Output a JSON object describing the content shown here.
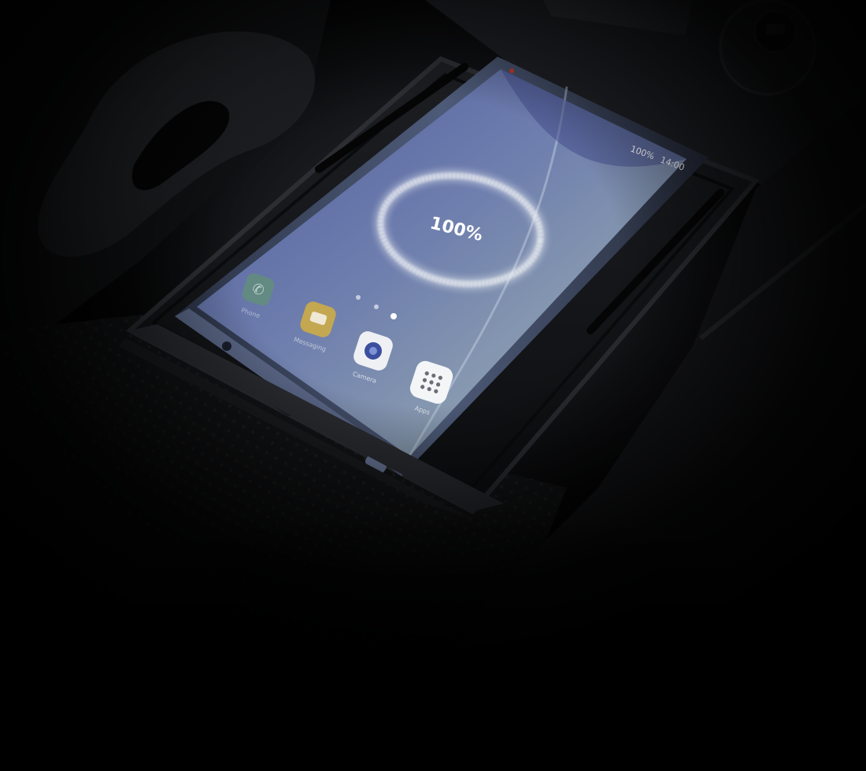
{
  "phone": {
    "status": {
      "battery": "100%",
      "time": "14:00"
    },
    "charge_display": "100%",
    "apps": [
      {
        "label": "Phone",
        "icon": "phone-icon"
      },
      {
        "label": "Messaging",
        "icon": "message-icon"
      },
      {
        "label": "Camera",
        "icon": "camera-icon"
      },
      {
        "label": "Apps",
        "icon": "apps-grid-icon"
      }
    ]
  },
  "colors": {
    "screen_top": "#5f6aa8",
    "screen_bottom": "#9cb3b0",
    "phone_body": "#3f4a63",
    "ring": "#f2f4f6"
  }
}
